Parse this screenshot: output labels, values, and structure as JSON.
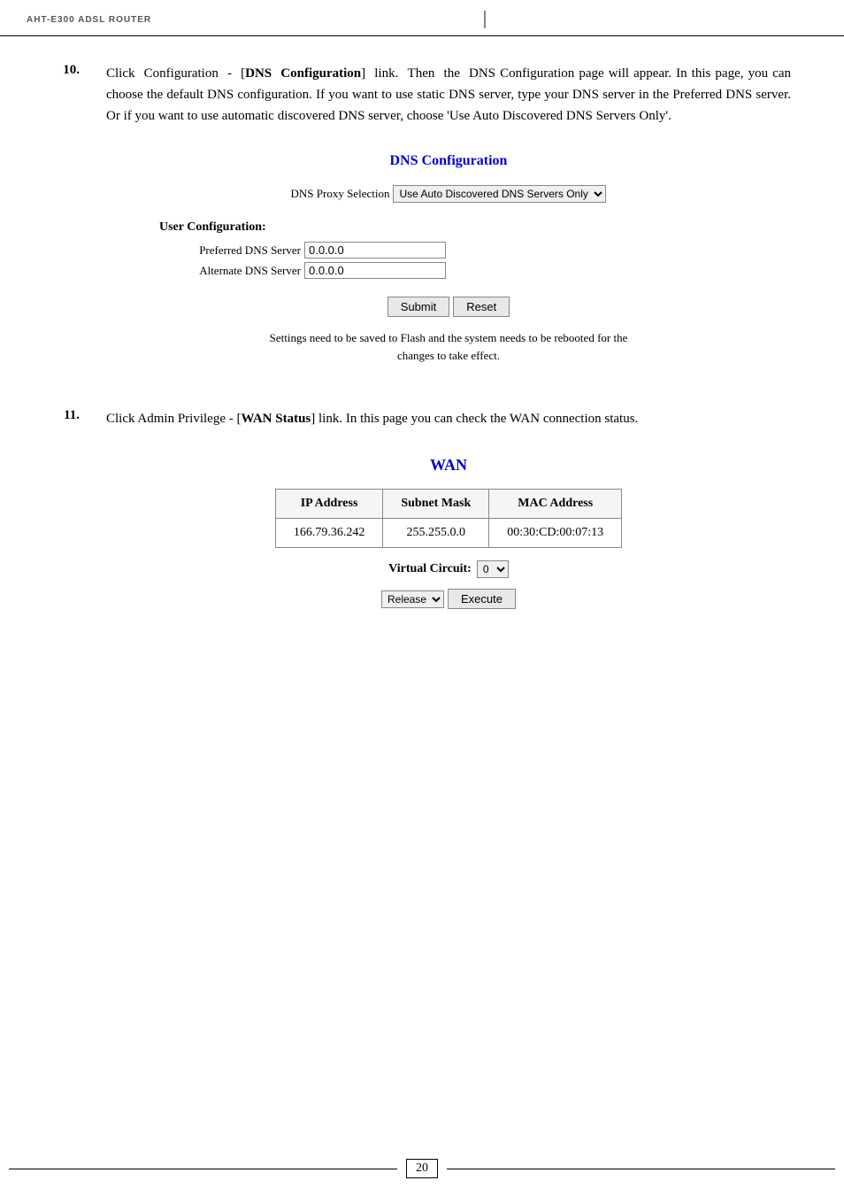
{
  "header": {
    "logo": "AHT-E300 ADSL ROUTER"
  },
  "step10": {
    "number": "10.",
    "text_parts": {
      "intro": "Click  Configuration  -  [",
      "bold": "DNS  Configuration",
      "rest": "]  link.  Then  the  DNS Configuration page will appear. In this page, you can choose the default DNS configuration. If you want to use static DNS server, type your DNS server in the Preferred DNS server. Or if you want to use automatic discovered DNS server, choose 'Use Auto Discovered DNS Servers Only'."
    },
    "dns_config": {
      "title": "DNS Configuration",
      "proxy_label": "DNS Proxy Selection",
      "proxy_value": "Use Auto Discovered DNS Servers Only",
      "user_config_title": "User Configuration:",
      "preferred_label": "Preferred DNS Server",
      "preferred_value": "0.0.0.0",
      "alternate_label": "Alternate DNS Server",
      "alternate_value": "0.0.0.0",
      "submit_label": "Submit",
      "reset_label": "Reset",
      "save_note_line1": "Settings need to be saved to Flash and the system needs to be rebooted for the",
      "save_note_line2": "changes to take effect."
    }
  },
  "step11": {
    "number": "11.",
    "text": "Click Admin Privilege - [WAN Status] link. In this page you can check the WAN connection status.",
    "text_bold": "WAN Status",
    "wan": {
      "title": "WAN",
      "table": {
        "headers": [
          "IP Address",
          "Subnet Mask",
          "MAC Address"
        ],
        "rows": [
          [
            "166.79.36.242",
            "255.255.0.0",
            "00:30:CD:00:07:13"
          ]
        ]
      },
      "virtual_circuit_label": "Virtual Circuit:",
      "virtual_circuit_value": "0",
      "release_label": "Release",
      "execute_label": "Execute"
    }
  },
  "footer": {
    "page_number": "20"
  }
}
